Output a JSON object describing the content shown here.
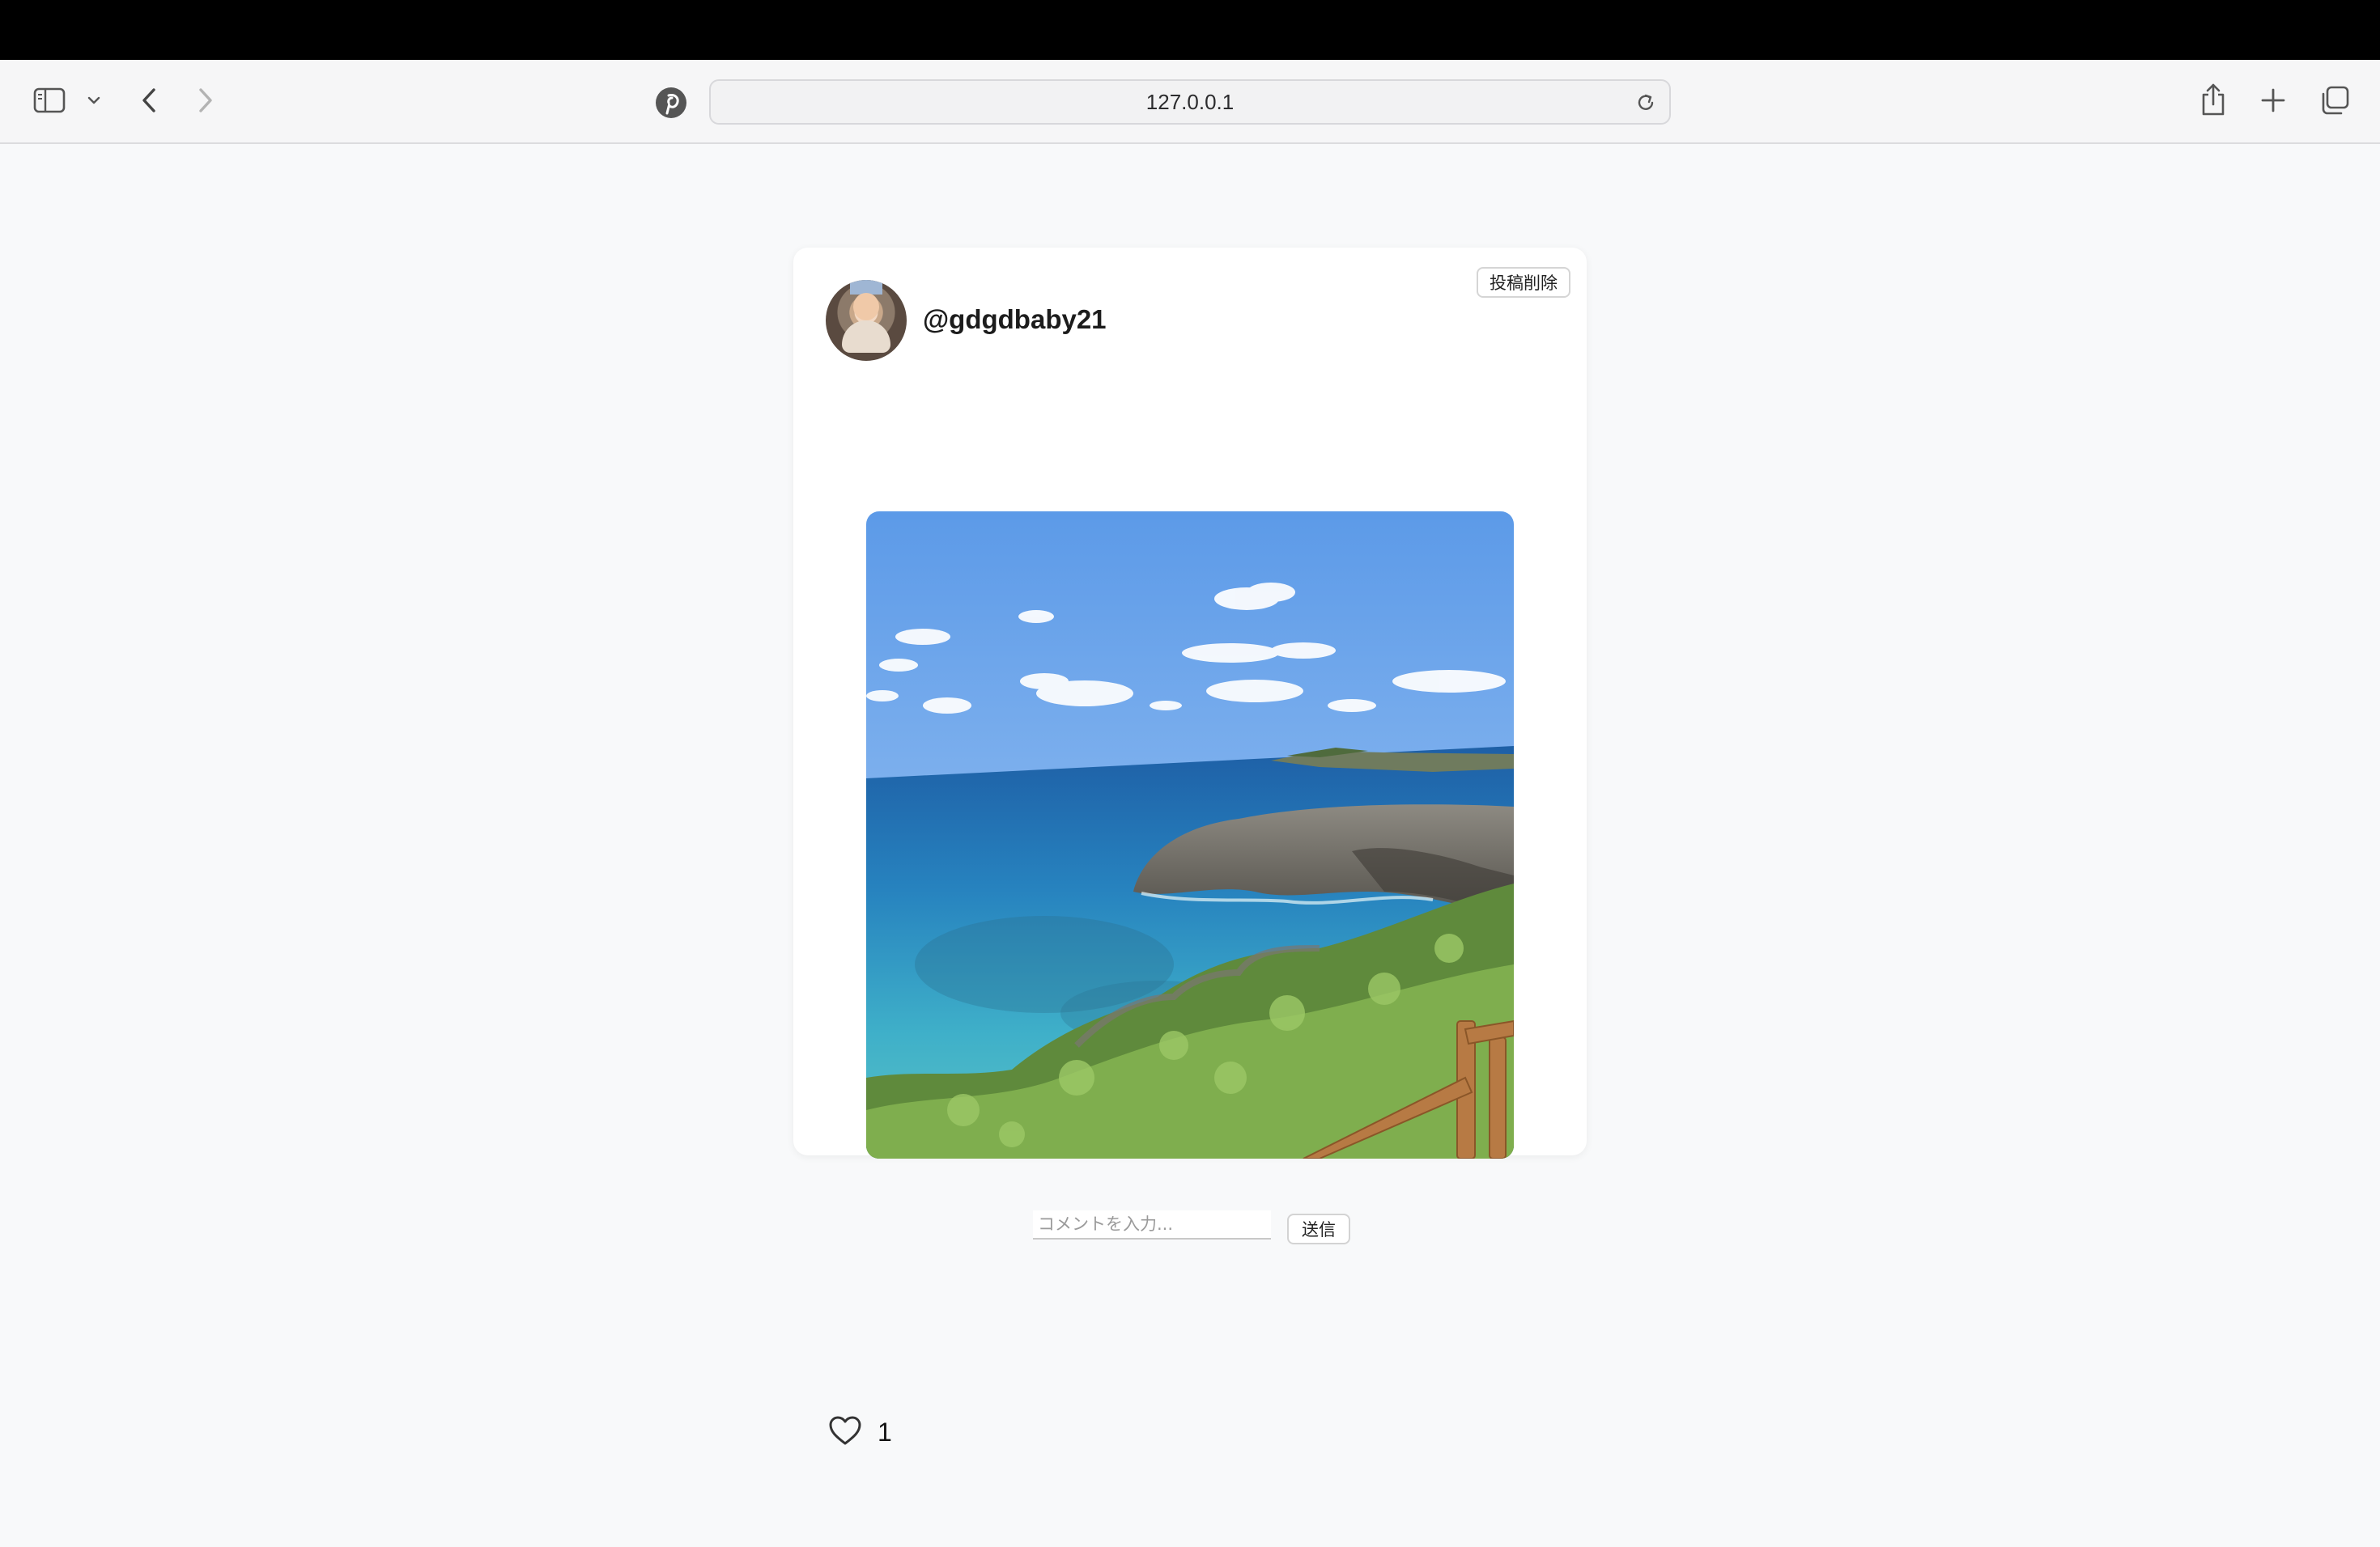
{
  "browser": {
    "url": "127.0.0.1",
    "icons": {
      "sidebar": "sidebar-icon",
      "sidebar_menu": "chevron-down-icon",
      "back": "chevron-left-icon",
      "forward": "chevron-right-icon",
      "site": "pinterest-icon",
      "reload": "reload-icon",
      "share": "share-icon",
      "new_tab": "plus-icon",
      "tabs": "tabs-overview-icon"
    }
  },
  "post": {
    "username": "@gdgdbaby21",
    "delete_label": "投稿削除",
    "likes": "1",
    "like_icon": "heart-icon",
    "comment_placeholder": "コメントを入力...",
    "comment_value": "",
    "send_label": "送信"
  },
  "colors": {
    "page_bg": "#f8f9fa",
    "card_bg": "#ffffff",
    "sky": "#6fa6ec",
    "sea": "#2c8fc0"
  }
}
